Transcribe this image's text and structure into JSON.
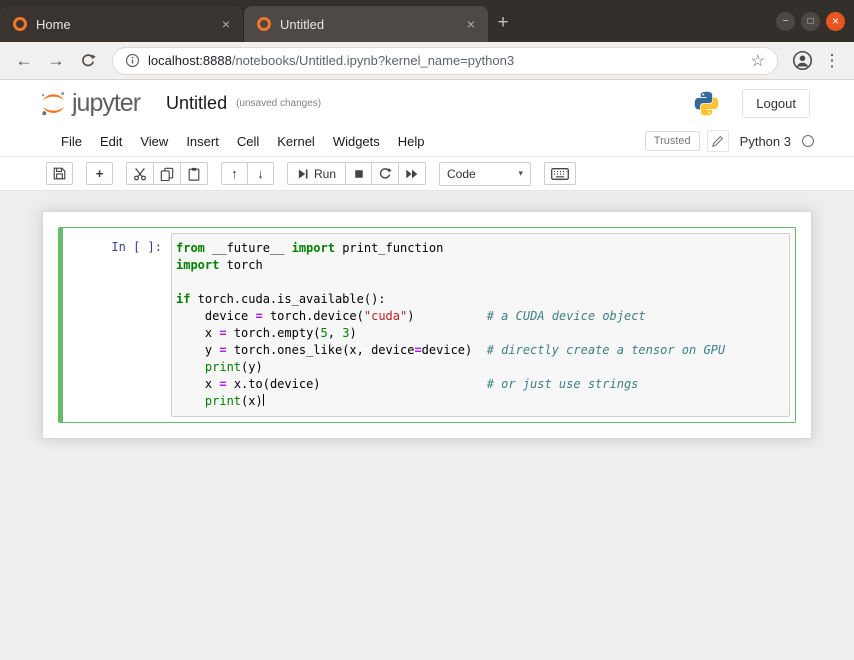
{
  "browser": {
    "tabs": [
      {
        "title": "Home",
        "active": false
      },
      {
        "title": "Untitled",
        "active": true
      }
    ],
    "url": {
      "host": "localhost:8888",
      "path": "/notebooks/Untitled.ipynb?kernel_name=python3"
    },
    "icons": {
      "close_tab": "×",
      "new_tab": "+",
      "minimize": "−",
      "maximize": "□",
      "close_window": "×",
      "back": "←",
      "forward": "→",
      "bookmark_star": "☆",
      "menu_dots": "⋮"
    }
  },
  "header": {
    "logo_text": "jupyter",
    "title": "Untitled",
    "autosave_status": "(unsaved changes)",
    "logout_label": "Logout"
  },
  "menubar": {
    "items": [
      "File",
      "Edit",
      "View",
      "Insert",
      "Cell",
      "Kernel",
      "Widgets",
      "Help"
    ],
    "trusted_label": "Trusted",
    "kernel_name": "Python 3"
  },
  "toolbar": {
    "run_label": "Run",
    "cell_type_value": "Code",
    "icons": {
      "add": "+",
      "move_up": "↑",
      "move_down": "↓",
      "caret": "▾"
    }
  },
  "notebook": {
    "prompt": "In [ ]:",
    "cursor_line": 9,
    "code_lines": [
      [
        {
          "c": "kw",
          "t": "from"
        },
        {
          "c": "pl",
          "t": " __future__ "
        },
        {
          "c": "kw",
          "t": "import"
        },
        {
          "c": "pl",
          "t": " print_function"
        }
      ],
      [
        {
          "c": "kw",
          "t": "import"
        },
        {
          "c": "pl",
          "t": " torch"
        }
      ],
      [],
      [
        {
          "c": "kw",
          "t": "if"
        },
        {
          "c": "pl",
          "t": " torch.cuda.is_available():"
        }
      ],
      [
        {
          "c": "pl",
          "t": "    device "
        },
        {
          "c": "op",
          "t": "="
        },
        {
          "c": "pl",
          "t": " torch.device("
        },
        {
          "c": "st",
          "t": "\"cuda\""
        },
        {
          "c": "pl",
          "t": ")          "
        },
        {
          "c": "cm",
          "t": "# a CUDA device object"
        }
      ],
      [
        {
          "c": "pl",
          "t": "    x "
        },
        {
          "c": "op",
          "t": "="
        },
        {
          "c": "pl",
          "t": " torch.empty("
        },
        {
          "c": "nu",
          "t": "5"
        },
        {
          "c": "pl",
          "t": ", "
        },
        {
          "c": "nu",
          "t": "3"
        },
        {
          "c": "pl",
          "t": ")"
        }
      ],
      [
        {
          "c": "pl",
          "t": "    y "
        },
        {
          "c": "op",
          "t": "="
        },
        {
          "c": "pl",
          "t": " torch.ones_like(x, device"
        },
        {
          "c": "op",
          "t": "="
        },
        {
          "c": "pl",
          "t": "device)  "
        },
        {
          "c": "cm",
          "t": "# directly create a tensor on GPU"
        }
      ],
      [
        {
          "c": "pl",
          "t": "    "
        },
        {
          "c": "bi",
          "t": "print"
        },
        {
          "c": "pl",
          "t": "(y)"
        }
      ],
      [
        {
          "c": "pl",
          "t": "    x "
        },
        {
          "c": "op",
          "t": "="
        },
        {
          "c": "pl",
          "t": " x.to(device)                       "
        },
        {
          "c": "cm",
          "t": "# or just use strings"
        }
      ],
      [
        {
          "c": "pl",
          "t": "    "
        },
        {
          "c": "bi",
          "t": "print"
        },
        {
          "c": "pl",
          "t": "(x)"
        }
      ]
    ]
  },
  "colors": {
    "jupyter_orange": "#f37726",
    "close_button_orange": "#e95420",
    "selected_cell_green": "#66bb6a",
    "prompt_blue": "#303f9f",
    "syntax_keyword": "#008000",
    "syntax_operator": "#aa22ff",
    "syntax_string": "#ba2121",
    "syntax_comment": "#408080",
    "syntax_number": "#008000"
  }
}
